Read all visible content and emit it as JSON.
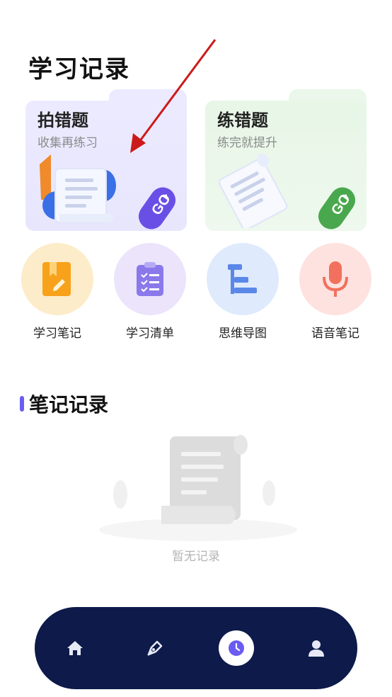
{
  "page": {
    "title": "学习记录"
  },
  "cards": [
    {
      "title": "拍错题",
      "subtitle": "收集再练习",
      "badge": "GO"
    },
    {
      "title": "练错题",
      "subtitle": "练完就提升",
      "badge": "GO"
    }
  ],
  "shortcuts": [
    {
      "label": "学习笔记",
      "icon": "notebook-pen-icon"
    },
    {
      "label": "学习清单",
      "icon": "clipboard-checklist-icon"
    },
    {
      "label": "思维导图",
      "icon": "mind-map-icon"
    },
    {
      "label": "语音笔记",
      "icon": "microphone-icon"
    }
  ],
  "notes_section": {
    "title": "笔记记录",
    "empty_text": "暂无记录"
  },
  "bottom_nav": {
    "items": [
      {
        "icon": "home-icon"
      },
      {
        "icon": "pen-nib-icon"
      },
      {
        "icon": "clock-icon",
        "active": true
      },
      {
        "icon": "user-icon"
      }
    ]
  },
  "colors": {
    "accent": "#6a5cf0",
    "nav_background": "#0d1a4a",
    "go_purple": "#6a4fe6",
    "go_green": "#49a84d",
    "annotation_arrow": "#cc1a1a"
  }
}
